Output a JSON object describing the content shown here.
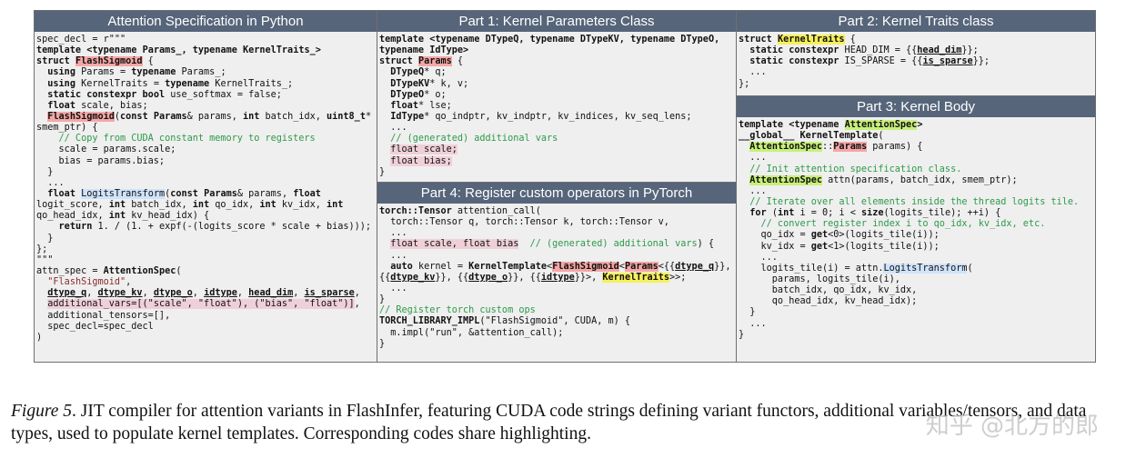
{
  "panels": {
    "python": {
      "title": "Attention Specification in Python"
    },
    "part1": {
      "title": "Part 1: Kernel Parameters Class"
    },
    "part2": {
      "title": "Part 2: Kernel Traits class"
    },
    "part3": {
      "title": "Part 3: Kernel Body"
    },
    "part4": {
      "title": "Part 4: Register custom operators in PyTorch"
    }
  },
  "code": {
    "python": [
      [
        [
          "spec_decl = r\"\"\"",
          ""
        ]
      ],
      [
        [
          "template",
          "k"
        ],
        [
          " <",
          "k"
        ],
        [
          "typename",
          "k"
        ],
        [
          " Params_, ",
          "k"
        ],
        [
          "typename",
          "k"
        ],
        [
          " KernelTraits_>",
          "k"
        ]
      ],
      [
        [
          "struct ",
          "k"
        ],
        [
          "FlashSigmoid",
          "k hr"
        ],
        [
          " {",
          ""
        ]
      ],
      [
        [
          "  ",
          ""
        ],
        [
          "using",
          "k"
        ],
        [
          " Params = ",
          ""
        ],
        [
          "typename",
          "k"
        ],
        [
          " Params_;",
          ""
        ]
      ],
      [
        [
          "  ",
          ""
        ],
        [
          "using",
          "k"
        ],
        [
          " KernelTraits = ",
          ""
        ],
        [
          "typename",
          "k"
        ],
        [
          " KernelTraits_;",
          ""
        ]
      ],
      [
        [
          "  ",
          ""
        ],
        [
          "static constexpr bool",
          "k"
        ],
        [
          " use_softmax = false;",
          ""
        ]
      ],
      [
        [
          "  ",
          ""
        ],
        [
          "float",
          "k"
        ],
        [
          " scale, bias;",
          ""
        ]
      ],
      [
        [
          "  ",
          ""
        ],
        [
          "FlashSigmoid",
          "k hr"
        ],
        [
          "(",
          ""
        ],
        [
          "const",
          "k"
        ],
        [
          " ",
          ""
        ],
        [
          "Params",
          "k"
        ],
        [
          "& params, ",
          ""
        ],
        [
          "int",
          "k"
        ],
        [
          " batch_idx, ",
          ""
        ],
        [
          "uint8_t",
          "k"
        ],
        [
          "*",
          ""
        ]
      ],
      [
        [
          "smem_ptr) {",
          ""
        ]
      ],
      [
        [
          "    // Copy from CUDA constant memory to registers",
          "c"
        ]
      ],
      [
        [
          "    scale = params.scale;",
          ""
        ]
      ],
      [
        [
          "    bias = params.bias;",
          ""
        ]
      ],
      [
        [
          "  }",
          ""
        ]
      ],
      [
        [
          "  ...",
          ""
        ]
      ],
      [
        [
          "  ",
          ""
        ],
        [
          "float",
          "k"
        ],
        [
          " ",
          ""
        ],
        [
          "LogitsTransform",
          "hb"
        ],
        [
          "(",
          ""
        ],
        [
          "const",
          "k"
        ],
        [
          " ",
          ""
        ],
        [
          "Params",
          "k"
        ],
        [
          "& params, ",
          ""
        ],
        [
          "float",
          "k"
        ]
      ],
      [
        [
          "logit_score, ",
          ""
        ],
        [
          "int",
          "k"
        ],
        [
          " batch_idx, ",
          ""
        ],
        [
          "int",
          "k"
        ],
        [
          " qo_idx, ",
          ""
        ],
        [
          "int",
          "k"
        ],
        [
          " kv_idx, ",
          ""
        ],
        [
          "int",
          "k"
        ]
      ],
      [
        [
          "qo_head_idx, ",
          ""
        ],
        [
          "int",
          "k"
        ],
        [
          " kv_head_idx) {",
          ""
        ]
      ],
      [
        [
          "    ",
          ""
        ],
        [
          "return",
          "k"
        ],
        [
          " 1. / (1. + expf(-(logits_score * scale + bias)));",
          ""
        ]
      ],
      [
        [
          "  }",
          ""
        ]
      ],
      [
        [
          "};",
          ""
        ]
      ],
      [
        [
          "\"\"\"",
          ""
        ]
      ],
      [
        [
          "attn_spec = ",
          ""
        ],
        [
          "AttentionSpec",
          "k"
        ],
        [
          "(",
          ""
        ]
      ],
      [
        [
          "  ",
          ""
        ],
        [
          "\"FlashSigmoid\"",
          "s"
        ],
        [
          ",",
          ""
        ]
      ],
      [
        [
          "  ",
          ""
        ],
        [
          "dtype_q",
          "u"
        ],
        [
          ", ",
          ""
        ],
        [
          "dtype_kv",
          "u"
        ],
        [
          ", ",
          ""
        ],
        [
          "dtype_o",
          "u"
        ],
        [
          ", ",
          ""
        ],
        [
          "idtype",
          "u"
        ],
        [
          ", ",
          ""
        ],
        [
          "head_dim",
          "u"
        ],
        [
          ", ",
          ""
        ],
        [
          "is_sparse",
          "u"
        ],
        [
          ",",
          ""
        ]
      ],
      [
        [
          "  ",
          ""
        ],
        [
          "additional_vars=[(\"scale\", \"float\"), (\"bias\", \"float\")]",
          "hp"
        ],
        [
          ",",
          ""
        ]
      ],
      [
        [
          "  additional_tensors=[],",
          ""
        ]
      ],
      [
        [
          "  spec_decl=spec_decl",
          ""
        ]
      ],
      [
        [
          ")",
          ""
        ]
      ]
    ],
    "part1": [
      [
        [
          "template",
          "k"
        ],
        [
          " <",
          "k"
        ],
        [
          "typename",
          "k"
        ],
        [
          " DTypeQ, ",
          "k"
        ],
        [
          "typename",
          "k"
        ],
        [
          " DTypeKV, ",
          "k"
        ],
        [
          "typename",
          "k"
        ],
        [
          " DTypeO,",
          "k"
        ]
      ],
      [
        [
          "typename",
          "k"
        ],
        [
          " IdType>",
          "k"
        ]
      ],
      [
        [
          "struct ",
          "k"
        ],
        [
          "Params",
          "k hr"
        ],
        [
          " {",
          ""
        ]
      ],
      [
        [
          "  ",
          ""
        ],
        [
          "DTypeQ",
          "k"
        ],
        [
          "* q;",
          ""
        ]
      ],
      [
        [
          "  ",
          ""
        ],
        [
          "DTypeKV",
          "k"
        ],
        [
          "* k, v;",
          ""
        ]
      ],
      [
        [
          "  ",
          ""
        ],
        [
          "DTypeO",
          "k"
        ],
        [
          "* o;",
          ""
        ]
      ],
      [
        [
          "  ",
          ""
        ],
        [
          "float",
          "k"
        ],
        [
          "* lse;",
          ""
        ]
      ],
      [
        [
          "  ",
          ""
        ],
        [
          "IdType",
          "k"
        ],
        [
          "* qo_indptr, kv_indptr, kv_indices, kv_seq_lens;",
          ""
        ]
      ],
      [
        [
          "  ...",
          ""
        ]
      ],
      [
        [
          "  // (generated) additional vars",
          "c"
        ]
      ],
      [
        [
          "  ",
          ""
        ],
        [
          "float scale;",
          "hp"
        ]
      ],
      [
        [
          "  ",
          ""
        ],
        [
          "float bias;",
          "hp"
        ]
      ],
      [
        [
          "}",
          ""
        ]
      ]
    ],
    "part2": [
      [
        [
          "struct ",
          "k"
        ],
        [
          "KernelTraits",
          "k hy"
        ],
        [
          " {",
          ""
        ]
      ],
      [
        [
          "  ",
          ""
        ],
        [
          "static constexpr",
          "k"
        ],
        [
          " HEAD_DIM = {{",
          ""
        ],
        [
          "head_dim",
          "u"
        ],
        [
          "}};",
          ""
        ]
      ],
      [
        [
          "  ",
          ""
        ],
        [
          "static constexpr",
          "k"
        ],
        [
          " IS_SPARSE = {{",
          ""
        ],
        [
          "is_sparse",
          "u"
        ],
        [
          "}};",
          ""
        ]
      ],
      [
        [
          "  ...",
          ""
        ]
      ],
      [
        [
          "};",
          ""
        ]
      ]
    ],
    "part3": [
      [
        [
          "template",
          "k"
        ],
        [
          " <",
          "k"
        ],
        [
          "typename",
          "k"
        ],
        [
          " ",
          ""
        ],
        [
          "AttentionSpec",
          "k hg"
        ],
        [
          ">",
          "k"
        ]
      ],
      [
        [
          "__global__",
          "k"
        ],
        [
          " ",
          ""
        ],
        [
          "KernelTemplate",
          "k"
        ],
        [
          "(",
          ""
        ]
      ],
      [
        [
          "  ",
          ""
        ],
        [
          "AttentionSpec",
          "k hg"
        ],
        [
          "::",
          ""
        ],
        [
          "Params",
          "k hr"
        ],
        [
          " params) {",
          ""
        ]
      ],
      [
        [
          "  ...",
          ""
        ]
      ],
      [
        [
          "  // Init attention specification class.",
          "c"
        ]
      ],
      [
        [
          "  ",
          ""
        ],
        [
          "AttentionSpec",
          "k hg"
        ],
        [
          " attn(params, batch_idx, smem_ptr);",
          ""
        ]
      ],
      [
        [
          "  ...",
          ""
        ]
      ],
      [
        [
          "  // Iterate over all elements inside the thread logits tile.",
          "c"
        ]
      ],
      [
        [
          "  ",
          ""
        ],
        [
          "for",
          "k"
        ],
        [
          " (",
          ""
        ],
        [
          "int",
          "k"
        ],
        [
          " i = 0; i < ",
          ""
        ],
        [
          "size",
          "k"
        ],
        [
          "(logits_tile); ++i) {",
          ""
        ]
      ],
      [
        [
          "    // convert register index i to qo_idx, kv_idx, etc.",
          "c"
        ]
      ],
      [
        [
          "    qo_idx = ",
          ""
        ],
        [
          "get",
          "k"
        ],
        [
          "<0>(logits_tile(i));",
          ""
        ]
      ],
      [
        [
          "    kv_idx = ",
          ""
        ],
        [
          "get",
          "k"
        ],
        [
          "<1>(logits_tile(i));",
          ""
        ]
      ],
      [
        [
          "    ...",
          ""
        ]
      ],
      [
        [
          "    logits_tile(i) = attn.",
          ""
        ],
        [
          "LogitsTransform",
          "hb"
        ],
        [
          "(",
          ""
        ]
      ],
      [
        [
          "      params, logits_tile(i),",
          ""
        ]
      ],
      [
        [
          "      batch_idx, qo_idx, kv_idx,",
          ""
        ]
      ],
      [
        [
          "      qo_head_idx, kv_head_idx);",
          ""
        ]
      ],
      [
        [
          "  }",
          ""
        ]
      ],
      [
        [
          "  ...",
          ""
        ]
      ],
      [
        [
          "}",
          ""
        ]
      ]
    ],
    "part4": [
      [
        [
          "torch::Tensor",
          "k"
        ],
        [
          " attention_call(",
          ""
        ]
      ],
      [
        [
          "  torch::Tensor q, torch::Tensor k, torch::Tensor v,",
          ""
        ]
      ],
      [
        [
          "  ...",
          ""
        ]
      ],
      [
        [
          "  ",
          ""
        ],
        [
          "float scale, float bias",
          "hp"
        ],
        [
          "  ",
          ""
        ],
        [
          "// (generated) additional vars",
          "c"
        ],
        [
          ") {",
          ""
        ]
      ],
      [
        [
          "  ...",
          ""
        ]
      ],
      [
        [
          "  ",
          ""
        ],
        [
          "auto",
          "k"
        ],
        [
          " kernel = ",
          ""
        ],
        [
          "KernelTemplate",
          "k"
        ],
        [
          "<",
          ""
        ],
        [
          "FlashSigmoid",
          "k hr"
        ],
        [
          "<",
          ""
        ],
        [
          "Params",
          "k hr"
        ],
        [
          "<{{",
          ""
        ],
        [
          "dtype_q",
          "u"
        ],
        [
          "}},",
          ""
        ]
      ],
      [
        [
          "{{",
          ""
        ],
        [
          "dtype_kv",
          "u"
        ],
        [
          "}}, {{",
          ""
        ],
        [
          "dtype_o",
          "u"
        ],
        [
          "}}, {{",
          ""
        ],
        [
          "idtype",
          "u"
        ],
        [
          "}}>, ",
          ""
        ],
        [
          "KernelTraits",
          "k hy"
        ],
        [
          ">>;",
          ""
        ]
      ],
      [
        [
          "  ...",
          ""
        ]
      ],
      [
        [
          "}",
          ""
        ]
      ],
      [
        [
          "// Register torch custom ops",
          "c"
        ]
      ],
      [
        [
          "TORCH_LIBRARY_IMPL",
          "k"
        ],
        [
          "(\"FlashSigmoid\", CUDA, m) {",
          ""
        ]
      ],
      [
        [
          "  m.impl(\"run\", &attention_call);",
          ""
        ]
      ],
      [
        [
          "}",
          ""
        ]
      ]
    ]
  },
  "caption": {
    "figure_label": "Figure 5",
    "text": ". JIT compiler for attention variants in FlashInfer, featuring CUDA code strings defining variant functors, additional variables/tensors, and data types, used to populate kernel templates. Corresponding codes share highlighting."
  },
  "watermark": "知乎 @北方的郎"
}
